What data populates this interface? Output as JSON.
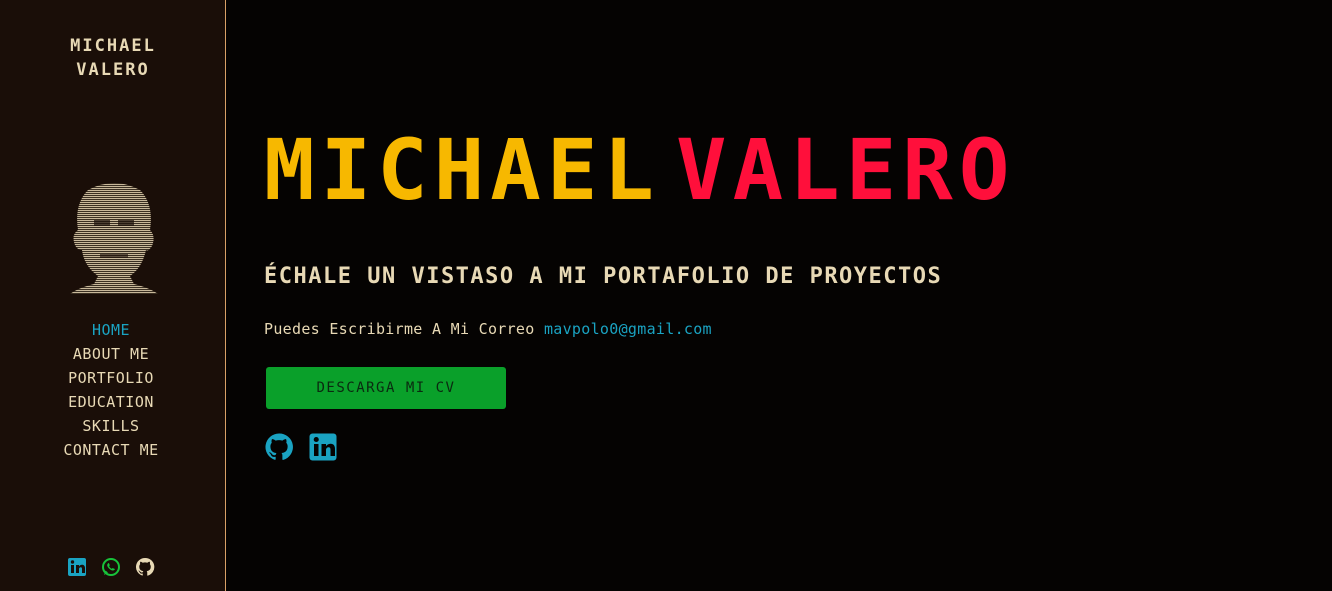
{
  "sidebar": {
    "brand_line1": "MICHAEL",
    "brand_line2": "VALERO",
    "nav": [
      {
        "label": "HOME",
        "active": true
      },
      {
        "label": "ABOUT ME"
      },
      {
        "label": "PORTFOLIO"
      },
      {
        "label": "EDUCATION"
      },
      {
        "label": "SKILLS"
      },
      {
        "label": "CONTACT ME"
      }
    ],
    "social_icons": [
      "linkedin-icon",
      "whatsapp-icon",
      "github-icon"
    ]
  },
  "hero": {
    "first_name": "MICHAEL",
    "last_name": "VALERO",
    "tagline": "ÉCHALE UN VISTASO A MI PORTAFOLIO DE PROYECTOS",
    "mail_label": "Puedes Escribirme A Mi Correo",
    "mail": "mavpolo0@gmail.com",
    "cv_button": "DESCARGA MI CV",
    "social_icons": [
      "github-icon",
      "linkedin-icon"
    ]
  },
  "colors": {
    "accent_yellow": "#f7b800",
    "accent_red": "#ff0f3b",
    "link_blue": "#1aa3c2",
    "button_green": "#0aa02a",
    "sidebar_bg": "#1a0e08",
    "page_bg": "#050302"
  }
}
